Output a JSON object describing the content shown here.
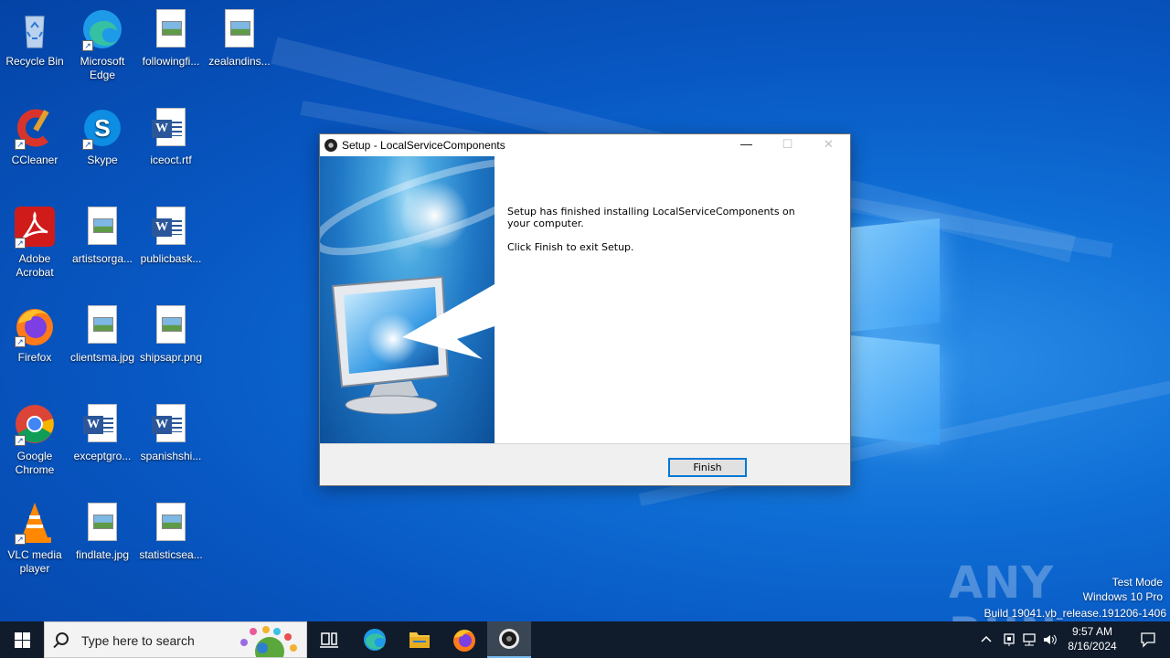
{
  "desktop": {
    "icons": [
      {
        "label": "Recycle Bin",
        "icon": "recycle-bin-icon"
      },
      {
        "label": "Microsoft Edge",
        "icon": "edge-icon"
      },
      {
        "label": "followingfi...",
        "icon": "image-file-icon"
      },
      {
        "label": "zealandins...",
        "icon": "image-file-icon"
      },
      {
        "label": "CCleaner",
        "icon": "ccleaner-icon"
      },
      {
        "label": "Skype",
        "icon": "skype-icon"
      },
      {
        "label": "iceoct.rtf",
        "icon": "word-file-icon"
      },
      {
        "label": "Adobe Acrobat",
        "icon": "acrobat-icon"
      },
      {
        "label": "artistsorga...",
        "icon": "image-file-icon"
      },
      {
        "label": "publicbask...",
        "icon": "word-file-icon"
      },
      {
        "label": "Firefox",
        "icon": "firefox-icon"
      },
      {
        "label": "clientsma.jpg",
        "icon": "image-file-icon"
      },
      {
        "label": "shipsapr.png",
        "icon": "image-file-icon"
      },
      {
        "label": "Google Chrome",
        "icon": "chrome-icon"
      },
      {
        "label": "exceptgro...",
        "icon": "word-file-icon"
      },
      {
        "label": "spanishshi...",
        "icon": "word-file-icon"
      },
      {
        "label": "VLC media player",
        "icon": "vlc-icon"
      },
      {
        "label": "findlate.jpg",
        "icon": "image-file-icon"
      },
      {
        "label": "statisticsea...",
        "icon": "image-file-icon"
      }
    ]
  },
  "dialog": {
    "title": "Setup - LocalServiceComponents",
    "minimize": "—",
    "maximize": "☐",
    "close": "✕",
    "message_line1": "Setup has finished installing LocalServiceComponents on your computer.",
    "message_line2": "Click Finish to exit Setup.",
    "finish_label": "Finish"
  },
  "watermark": {
    "test_mode": "Test Mode",
    "edition": "Windows 10 Pro",
    "build": "Build 19041.vb_release.191206-1406",
    "brand": "ANY RUN"
  },
  "taskbar": {
    "search_placeholder": "Type here to search",
    "time": "9:57 AM",
    "date": "8/16/2024",
    "apps": [
      "task-view-icon",
      "edge-icon",
      "file-explorer-icon",
      "firefox-icon",
      "setup-app-icon"
    ]
  },
  "colors": {
    "desktop_blue": "#0b63cc",
    "taskbar": "#101c2c",
    "accent": "#0078d7"
  }
}
